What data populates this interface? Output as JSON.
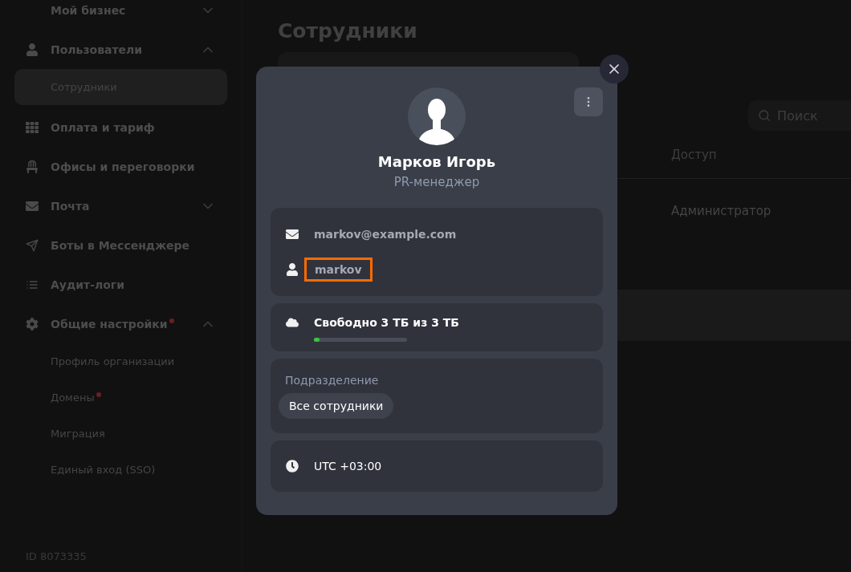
{
  "sidebar": {
    "items": [
      {
        "kind": "group",
        "label": "Мой бизнес",
        "expanded": false,
        "alert": false,
        "selected": false
      },
      {
        "kind": "group",
        "label": "Пользователи",
        "expanded": true,
        "alert": false,
        "selected": false,
        "children": [
          {
            "label": "Сотрудники",
            "selected": true,
            "alert": false
          }
        ]
      },
      {
        "kind": "link",
        "label": "Оплата и тариф",
        "alert": false,
        "selected": false
      },
      {
        "kind": "link",
        "label": "Офисы и переговорки",
        "alert": false,
        "selected": false
      },
      {
        "kind": "group",
        "label": "Почта",
        "expanded": false,
        "alert": false,
        "selected": false
      },
      {
        "kind": "link",
        "label": "Боты в Мессенджере",
        "alert": false,
        "selected": false
      },
      {
        "kind": "link",
        "label": "Аудит-логи",
        "alert": false,
        "selected": false
      },
      {
        "kind": "group",
        "label": "Общие настройки",
        "expanded": true,
        "alert": true,
        "selected": false,
        "children": [
          {
            "label": "Профиль организации",
            "selected": false,
            "alert": false
          },
          {
            "label": "Домены",
            "selected": false,
            "alert": true
          },
          {
            "label": "Миграция",
            "selected": false,
            "alert": false
          },
          {
            "label": "Единый вход (SSO)",
            "selected": false,
            "alert": false
          }
        ]
      }
    ],
    "org_id": "ID 8073335"
  },
  "page": {
    "title": "Сотрудники",
    "search": {
      "placeholder": "Поиск"
    },
    "table": {
      "columns": [
        "Доступ"
      ],
      "rows": [
        {
          "access": "Администратор",
          "selected": false
        },
        {
          "selected": true
        }
      ]
    }
  },
  "profile": {
    "name": "Марков Игорь",
    "position": "PR-менеджер",
    "email": "markov@example.com",
    "login": "markov",
    "login_highlighted": true,
    "storage": {
      "text": "Свободно 3 ТБ из 3 ТБ",
      "level": 0.06
    },
    "department": {
      "label": "Подразделение",
      "value": "Все сотрудники"
    },
    "timezone": "UTC +03:00"
  }
}
